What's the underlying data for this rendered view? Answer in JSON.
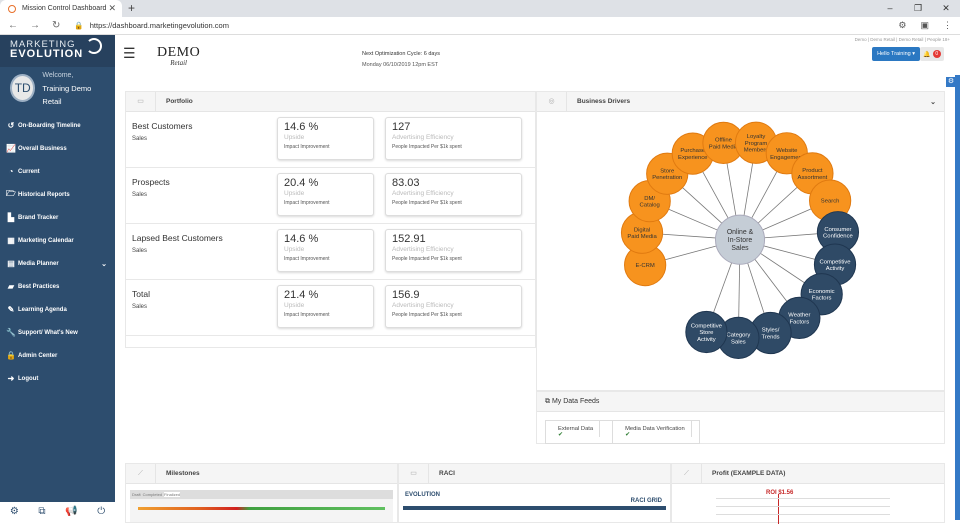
{
  "browser": {
    "tab_title": "Mission Control Dashboard",
    "url": "https://dashboard.marketingevolution.com"
  },
  "sidebar": {
    "logo_line1": "MARKETING",
    "logo_line2": "EVOLUTION",
    "avatar_initials": "TD",
    "welcome": "Welcome,",
    "user_name": "Training Demo Retail",
    "items": [
      {
        "label": "On-Boarding Timeline",
        "icon": "↺"
      },
      {
        "label": "Overall Business",
        "icon": "📈"
      },
      {
        "label": "Current",
        "icon": "◔"
      },
      {
        "label": "Historical Reports",
        "icon": "🗁"
      },
      {
        "label": "Brand Tracker",
        "icon": "▙"
      },
      {
        "label": "Marketing Calendar",
        "icon": "▦"
      },
      {
        "label": "Media Planner",
        "icon": "▤"
      },
      {
        "label": "Best Practices",
        "icon": "▰"
      },
      {
        "label": "Learning Agenda",
        "icon": "✎"
      },
      {
        "label": "Support/ What's New",
        "icon": "🔧"
      },
      {
        "label": "Admin Center",
        "icon": "🔒"
      },
      {
        "label": "Logout",
        "icon": "➜"
      }
    ]
  },
  "header": {
    "brand": "DEMO",
    "brand_sub": "Retail",
    "cycle_title": "Next Optimization Cycle: 6 days",
    "cycle_date": "Monday 06/10/2019 12pm EST",
    "breadcrumb": "Demo | Demo Retail | Demo Retail | People 18+",
    "user_button": "Hello Training ▾",
    "notification_count": "0"
  },
  "portfolio": {
    "title": "Portfolio",
    "rows": [
      {
        "name": "Best Customers",
        "sub": "Sales",
        "upside": "14.6 %",
        "upside_label": "Upside",
        "upside_desc": "Impact Improvement",
        "eff": "127",
        "eff_label": "Advertising Efficiency",
        "eff_desc": "People Impacted Per $1k spent"
      },
      {
        "name": "Prospects",
        "sub": "Sales",
        "upside": "20.4 %",
        "upside_label": "Upside",
        "upside_desc": "Impact Improvement",
        "eff": "83.03",
        "eff_label": "Advertising Efficiency",
        "eff_desc": "People Impacted Per $1k spent"
      },
      {
        "name": "Lapsed Best Customers",
        "sub": "Sales",
        "upside": "14.6 %",
        "upside_label": "Upside",
        "upside_desc": "Impact Improvement",
        "eff": "152.91",
        "eff_label": "Advertising Efficiency",
        "eff_desc": "People Impacted Per $1k spent"
      },
      {
        "name": "Total",
        "sub": "Sales",
        "upside": "21.4 %",
        "upside_label": "Upside",
        "upside_desc": "Impact Improvement",
        "eff": "156.9",
        "eff_label": "Advertising Efficiency",
        "eff_desc": "People Impacted Per $1k spent"
      }
    ]
  },
  "drivers": {
    "title": "Business Drivers",
    "center": "Online & In-Store Sales",
    "orange_color": "#f7931e",
    "blue_color": "#2f4a66",
    "center_color": "#c5cdd6",
    "nodes": [
      {
        "label": "E-CRM",
        "type": "orange"
      },
      {
        "label": "Digital Paid Media",
        "type": "orange"
      },
      {
        "label": "DM/ Catalog",
        "type": "orange"
      },
      {
        "label": "Store Penetration",
        "type": "orange"
      },
      {
        "label": "Purchase Experience",
        "type": "orange"
      },
      {
        "label": "Offline Paid Media",
        "type": "orange"
      },
      {
        "label": "Loyalty Program Members",
        "type": "orange"
      },
      {
        "label": "Website Engagement",
        "type": "orange"
      },
      {
        "label": "Product Assortment",
        "type": "orange"
      },
      {
        "label": "Search",
        "type": "orange"
      },
      {
        "label": "Consumer Confidence",
        "type": "blue"
      },
      {
        "label": "Competitive Activity",
        "type": "blue"
      },
      {
        "label": "Economic Factors",
        "type": "blue"
      },
      {
        "label": "Weather Factors",
        "type": "blue"
      },
      {
        "label": "Styles/ Trends",
        "type": "blue"
      },
      {
        "label": "Category Sales",
        "type": "blue"
      },
      {
        "label": "Competitive Store Activity",
        "type": "blue"
      }
    ]
  },
  "feeds": {
    "title": "My Data Feeds",
    "items": [
      "External Data",
      "Media Data Verification"
    ],
    "status_icon": "✔"
  },
  "bottom": {
    "milestones": "Milestones",
    "raci": "RACI",
    "profit": "Profit (EXAMPLE DATA)",
    "raci_grid": "RACI GRID",
    "roi": "ROI $1.56",
    "milestone_tabs": [
      "Draft",
      "Completed",
      "Finalized"
    ]
  }
}
